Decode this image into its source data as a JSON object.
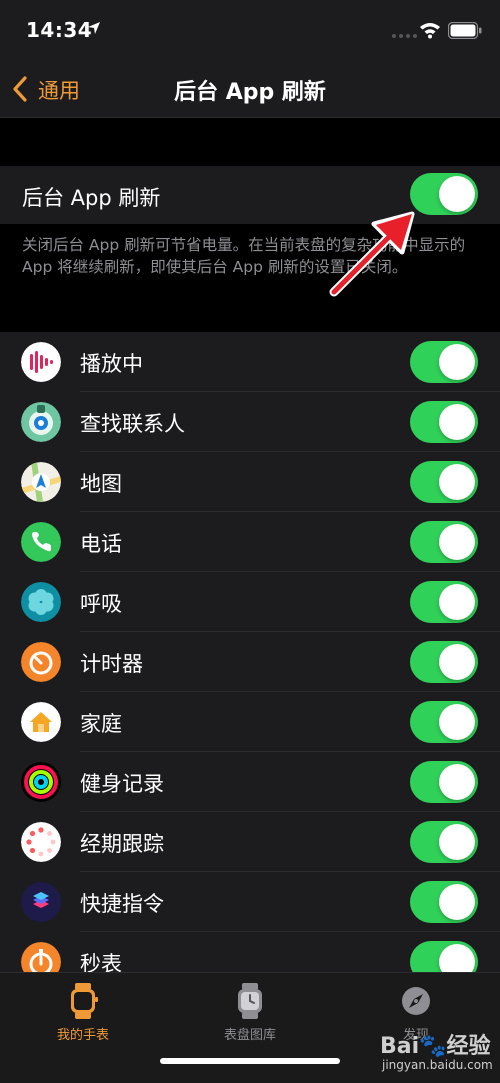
{
  "status_bar": {
    "time": "14:34",
    "icons": [
      "location-arrow-icon",
      "signal-dots-icon",
      "wifi-icon",
      "battery-icon"
    ]
  },
  "nav": {
    "back_label": "通用",
    "title": "后台 App 刷新"
  },
  "master": {
    "label": "后台 App 刷新",
    "enabled": true,
    "footer": "关闭后台 App 刷新可节省电量。在当前表盘的复杂功能中显示的 App 将继续刷新，即使其后台 App 刷新的设置已关闭。"
  },
  "apps": [
    {
      "label": "播放中",
      "icon": "now-playing-icon",
      "enabled": true
    },
    {
      "label": "查找联系人",
      "icon": "find-people-icon",
      "enabled": true
    },
    {
      "label": "地图",
      "icon": "maps-icon",
      "enabled": true
    },
    {
      "label": "电话",
      "icon": "phone-icon",
      "enabled": true
    },
    {
      "label": "呼吸",
      "icon": "breathe-icon",
      "enabled": true
    },
    {
      "label": "计时器",
      "icon": "timer-icon",
      "enabled": true
    },
    {
      "label": "家庭",
      "icon": "home-icon",
      "enabled": true
    },
    {
      "label": "健身记录",
      "icon": "activity-icon",
      "enabled": true
    },
    {
      "label": "经期跟踪",
      "icon": "cycle-tracking-icon",
      "enabled": true
    },
    {
      "label": "快捷指令",
      "icon": "shortcuts-icon",
      "enabled": true
    },
    {
      "label": "秒表",
      "icon": "stopwatch-icon",
      "enabled": true
    }
  ],
  "tabs": [
    {
      "label": "我的手表",
      "icon": "watch-icon",
      "active": true
    },
    {
      "label": "表盘图库",
      "icon": "watch-face-icon",
      "active": false
    },
    {
      "label": "发现",
      "icon": "compass-icon",
      "active": false
    }
  ],
  "watermark": {
    "logo": "Bai🐾经验",
    "url": "jingyan.baidu.com"
  },
  "colors": {
    "accent": "#f09a37",
    "toggle_on": "#30d158",
    "background": "#000000",
    "cell": "#1c1c1e",
    "secondary_text": "#8e8e93",
    "annotation_arrow": "#e8202a"
  }
}
